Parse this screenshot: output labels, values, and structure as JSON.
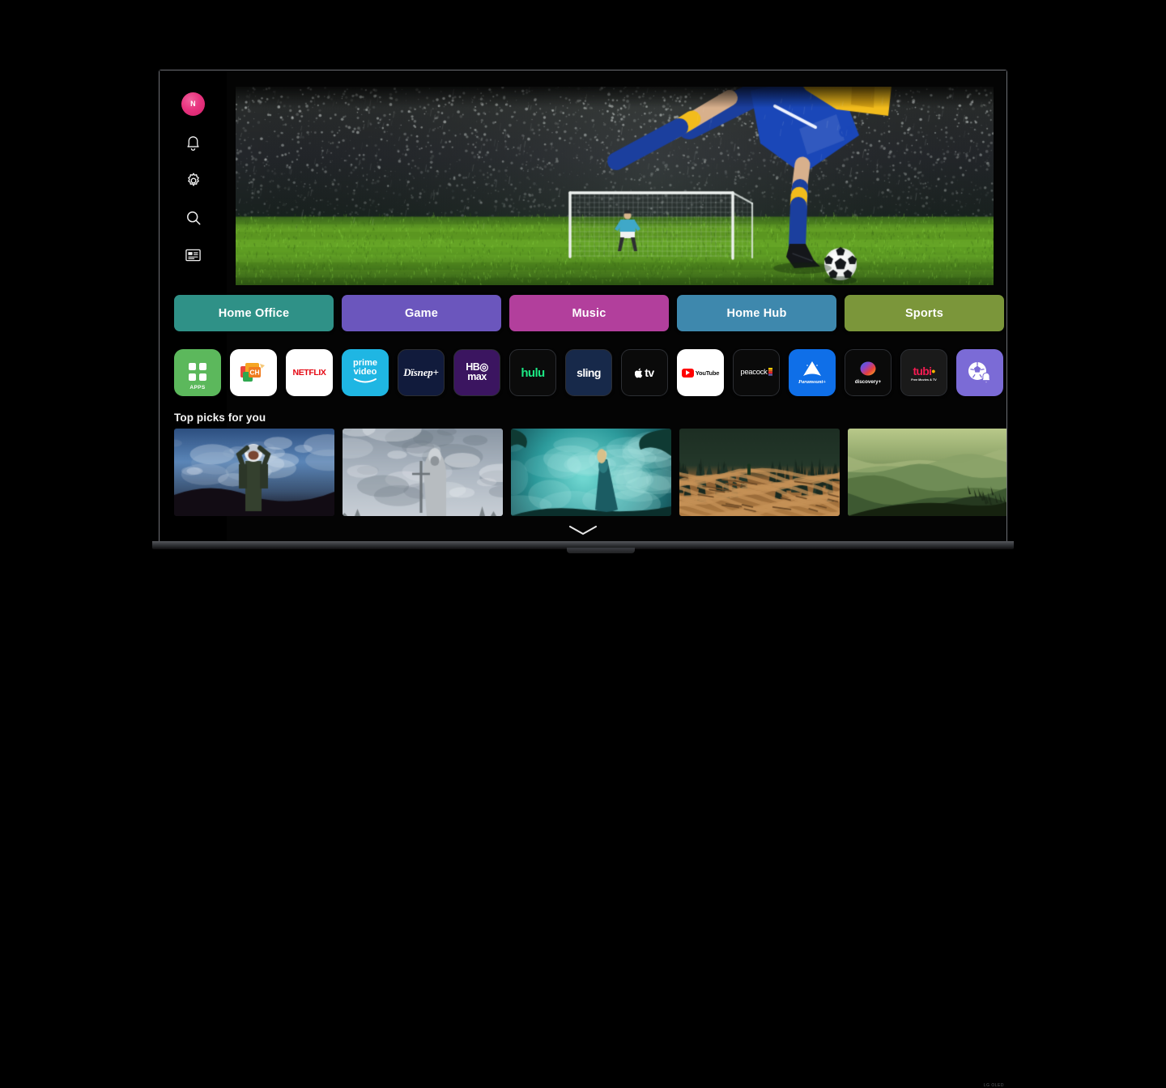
{
  "device": {
    "brand_mark": "LG OLED"
  },
  "sidebar": {
    "profile": {
      "initial": "N",
      "name": "profile-avatar",
      "color": "#e8347f"
    },
    "items": [
      {
        "label": "Notifications",
        "icon": "bell-icon"
      },
      {
        "label": "Settings",
        "icon": "gear-icon"
      },
      {
        "label": "Search",
        "icon": "search-icon"
      },
      {
        "label": "Guide",
        "icon": "guide-icon"
      }
    ]
  },
  "hero": {
    "name": "hero-banner",
    "description": "Soccer player kicking ball toward goal in the rain at night"
  },
  "categories": [
    {
      "label": "Home Office",
      "color": "#2f9187"
    },
    {
      "label": "Game",
      "color": "#6b56bd"
    },
    {
      "label": "Music",
      "color": "#b23f9c"
    },
    {
      "label": "Home Hub",
      "color": "#3e88ad"
    },
    {
      "label": "Sports",
      "color": "#7b963a"
    }
  ],
  "apps": [
    {
      "label": "APPS",
      "icon": "apps-grid-icon",
      "bg": "#5cb85c",
      "theme": "apps"
    },
    {
      "label": "Channels",
      "icon": "channels-icon",
      "bg": "#ffffff",
      "theme": "channels"
    },
    {
      "label": "NETFLIX",
      "icon": "netflix-icon",
      "bg": "#ffffff",
      "theme": "netflix"
    },
    {
      "label": "prime video",
      "icon": "prime-video-icon",
      "bg": "#1fb6e3",
      "theme": "prime"
    },
    {
      "label": "Disney+",
      "icon": "disney-plus-icon",
      "bg": "#111b3c",
      "theme": "disney"
    },
    {
      "label": "HBO max",
      "icon": "hbo-max-icon",
      "bg": "#3b1560",
      "theme": "hbo"
    },
    {
      "label": "hulu",
      "icon": "hulu-icon",
      "bg": "#0b0b0b",
      "theme": "hulu"
    },
    {
      "label": "sling",
      "icon": "sling-icon",
      "bg": "#17294a",
      "theme": "sling"
    },
    {
      "label": "Apple TV",
      "icon": "apple-tv-icon",
      "bg": "#0a0a0a",
      "theme": "appletv"
    },
    {
      "label": "YouTube",
      "icon": "youtube-icon",
      "bg": "#ffffff",
      "theme": "youtube"
    },
    {
      "label": "peacock",
      "icon": "peacock-icon",
      "bg": "#0a0a0a",
      "theme": "peacock"
    },
    {
      "label": "Paramount+",
      "icon": "paramount-plus-icon",
      "bg": "#0f6fe8",
      "theme": "paramount"
    },
    {
      "label": "discovery+",
      "icon": "discovery-plus-icon",
      "bg": "#0a0a0a",
      "theme": "discovery"
    },
    {
      "label": "tubi Free Movies & TV",
      "icon": "tubi-icon",
      "bg": "#1a1a1a",
      "theme": "tubi"
    },
    {
      "label": "Sports Alert",
      "icon": "sports-alert-icon",
      "bg": "#7b6bd6",
      "theme": "sportsalert"
    }
  ],
  "top_picks": {
    "title": "Top picks for you",
    "cards": [
      {
        "name": "astronaut-mountain-poster",
        "description": "Astronaut in helmet against cloudy blue sky",
        "palette": "blue-clouds"
      },
      {
        "name": "knight-statue-poster",
        "description": "Stone knight statue with sword in clouds",
        "palette": "grey-sky"
      },
      {
        "name": "woman-teal-mist-poster",
        "description": "Woman in gown in teal misty forest",
        "palette": "teal-mist"
      },
      {
        "name": "wooden-maze-poster",
        "description": "Aerial wooden maze in a forest",
        "palette": "wood-maze"
      },
      {
        "name": "green-hills-poster",
        "description": "Layered green hills in haze",
        "palette": "green-hills"
      }
    ]
  },
  "footer": {
    "scroll_chevron": "chevron-down-icon"
  }
}
